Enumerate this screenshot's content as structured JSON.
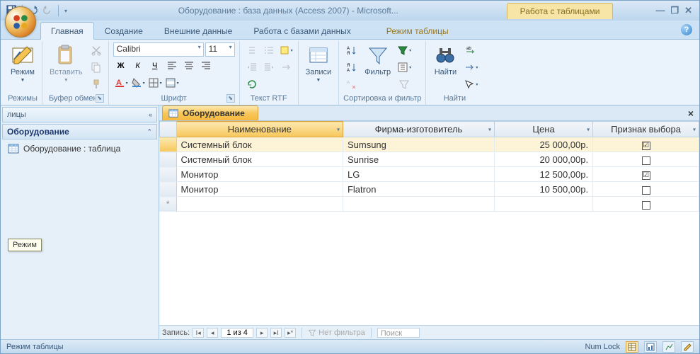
{
  "titlebar": {
    "title": "Оборудование : база данных (Access 2007) - Microsoft...",
    "contextual_title": "Работа с таблицами"
  },
  "tabs": {
    "main": "Главная",
    "create": "Создание",
    "external": "Внешние данные",
    "db_tools": "Работа с базами данных",
    "table_mode": "Режим таблицы"
  },
  "ribbon": {
    "modes_group": "Режимы",
    "mode_btn": "Режим",
    "clipboard_group": "Буфер обмена",
    "paste_btn": "Вставить",
    "font_group": "Шрифт",
    "font_name": "Calibri",
    "font_size": "11",
    "rtf_group": "Текст RTF",
    "records_group": "Записи",
    "records_btn": "Записи",
    "sortfilter_group": "Сортировка и фильтр",
    "filter_btn": "Фильтр",
    "find_group": "Найти",
    "find_btn": "Найти"
  },
  "navpane": {
    "header": "лицы",
    "group": "Оборудование",
    "item": "Оборудование : таблица"
  },
  "doctab": {
    "label": "Оборудование"
  },
  "datasheet": {
    "columns": {
      "name": "Наименование",
      "manufacturer": "Фирма-изготовитель",
      "price": "Цена",
      "flag": "Признак выбора"
    },
    "rows": [
      {
        "name": "Системный блок",
        "manufacturer": "Sumsung",
        "price": "25 000,00р.",
        "flag": true
      },
      {
        "name": "Системный блок",
        "manufacturer": "Sunrise",
        "price": "20 000,00р.",
        "flag": false
      },
      {
        "name": "Монитор",
        "manufacturer": "LG",
        "price": "12 500,00р.",
        "flag": true
      },
      {
        "name": "Монитор",
        "manufacturer": "Flatron",
        "price": "10 500,00р.",
        "flag": false
      }
    ]
  },
  "recnav": {
    "label": "Запись:",
    "position": "1 из 4",
    "no_filter": "Нет фильтра",
    "search": "Поиск"
  },
  "statusbar": {
    "mode": "Режим таблицы",
    "numlock": "Num Lock"
  },
  "tooltip": "Режим"
}
